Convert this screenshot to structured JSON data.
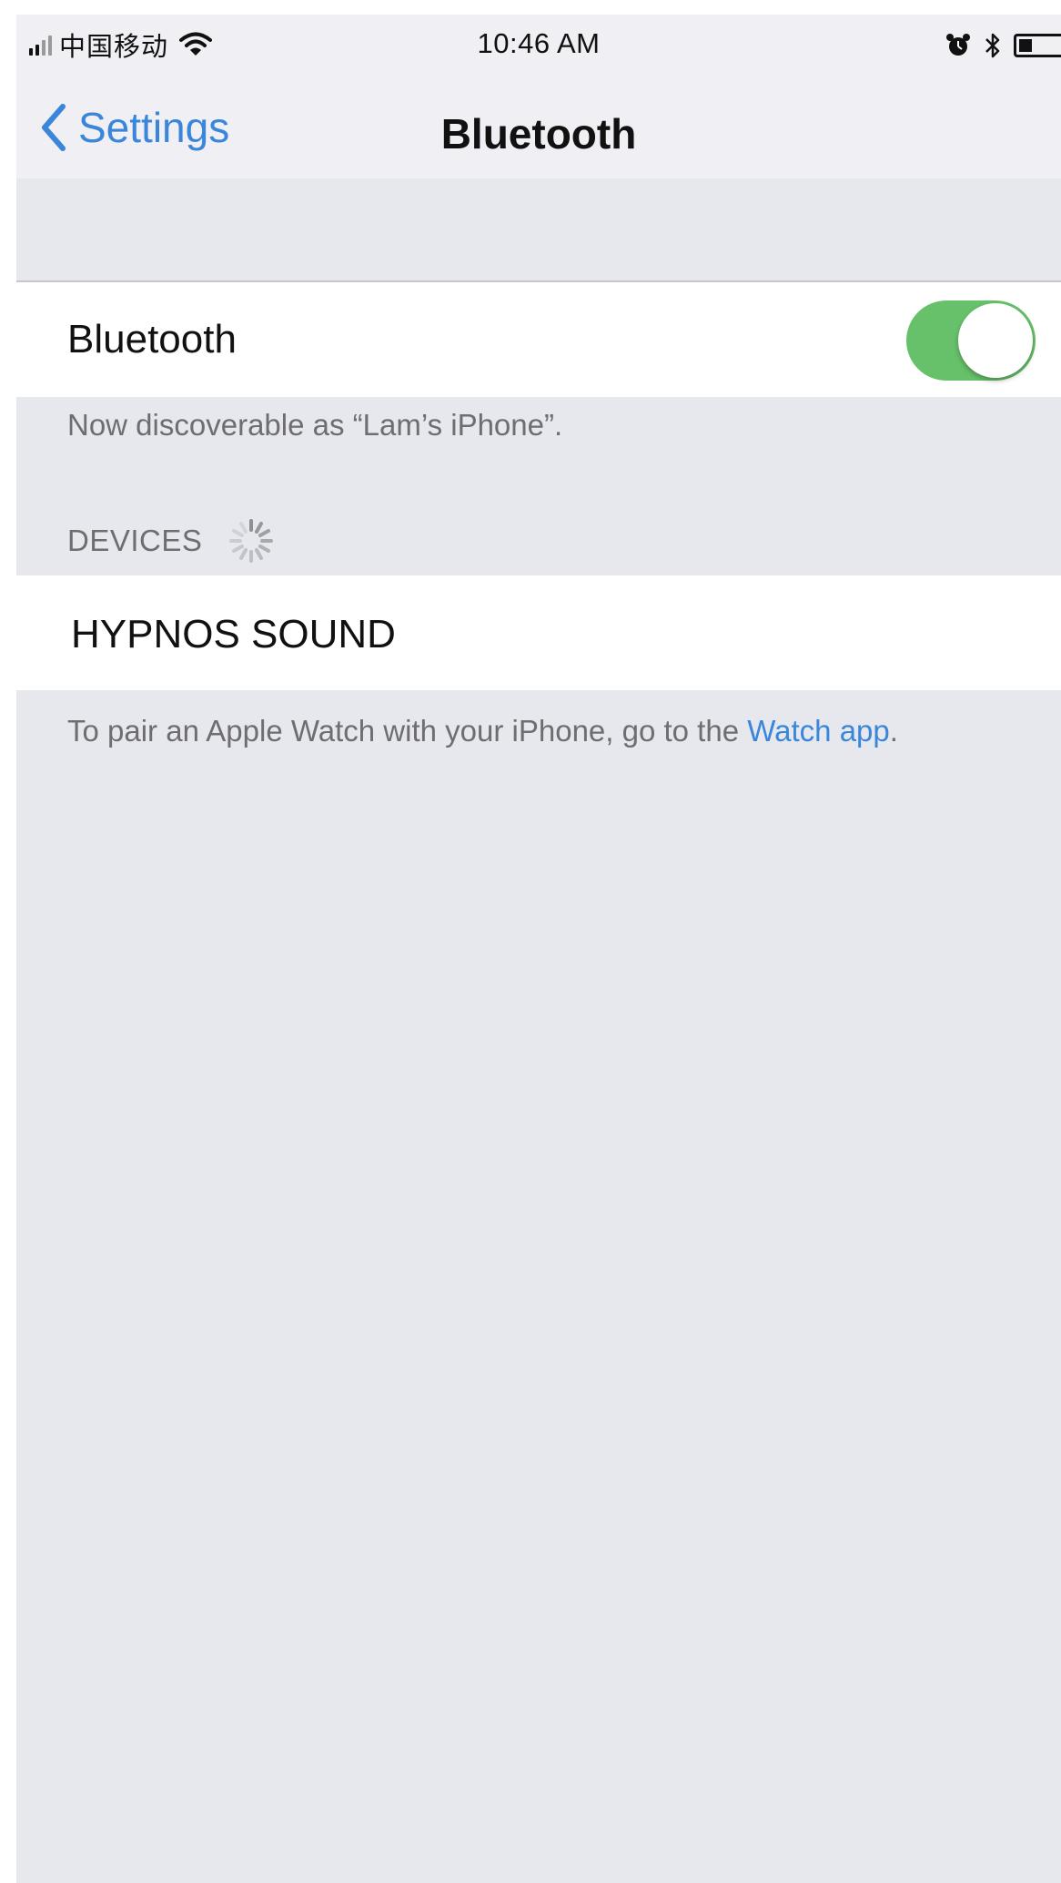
{
  "status_bar": {
    "carrier": "中国移动",
    "time": "10:46 AM",
    "battery_level": 0.35
  },
  "nav": {
    "back_label": "Settings",
    "title": "Bluetooth"
  },
  "bluetooth_toggle": {
    "label": "Bluetooth",
    "on": true,
    "on_color": "#67c16a"
  },
  "discoverable_text": "Now discoverable as “Lam’s iPhone”.",
  "devices": {
    "header": "DEVICES",
    "items": [
      {
        "name": "HYPNOS SOUND"
      }
    ]
  },
  "pair_hint": {
    "prefix": "To pair an Apple Watch with your iPhone, go to the",
    "link": "Watch app",
    "suffix": "."
  },
  "colors": {
    "accent": "#3a86db",
    "background": "#e7e8ed"
  },
  "icons": [
    "signal-icon",
    "wifi-icon",
    "alarm-icon",
    "bluetooth-icon",
    "battery-icon",
    "chevron-left-icon",
    "spinner-icon"
  ]
}
